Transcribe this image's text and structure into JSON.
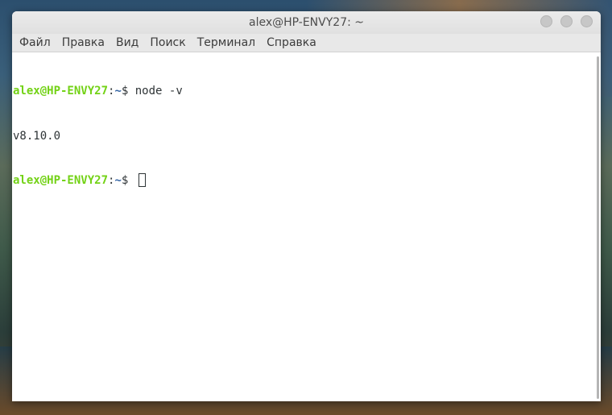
{
  "window": {
    "title": "alex@HP-ENVY27: ~"
  },
  "menu": {
    "items": [
      "Файл",
      "Правка",
      "Вид",
      "Поиск",
      "Терминал",
      "Справка"
    ]
  },
  "terminal": {
    "lines": [
      {
        "user": "alex@HP-ENVY27",
        "sep": ":",
        "path": "~",
        "symbol": "$ ",
        "command": "node -v"
      },
      {
        "output": "v8.10.0"
      },
      {
        "user": "alex@HP-ENVY27",
        "sep": ":",
        "path": "~",
        "symbol": "$ ",
        "command": ""
      }
    ]
  },
  "colors": {
    "prompt_user": "#73d216",
    "prompt_path": "#3465a4",
    "text": "#2e3436",
    "background": "#ffffff"
  }
}
